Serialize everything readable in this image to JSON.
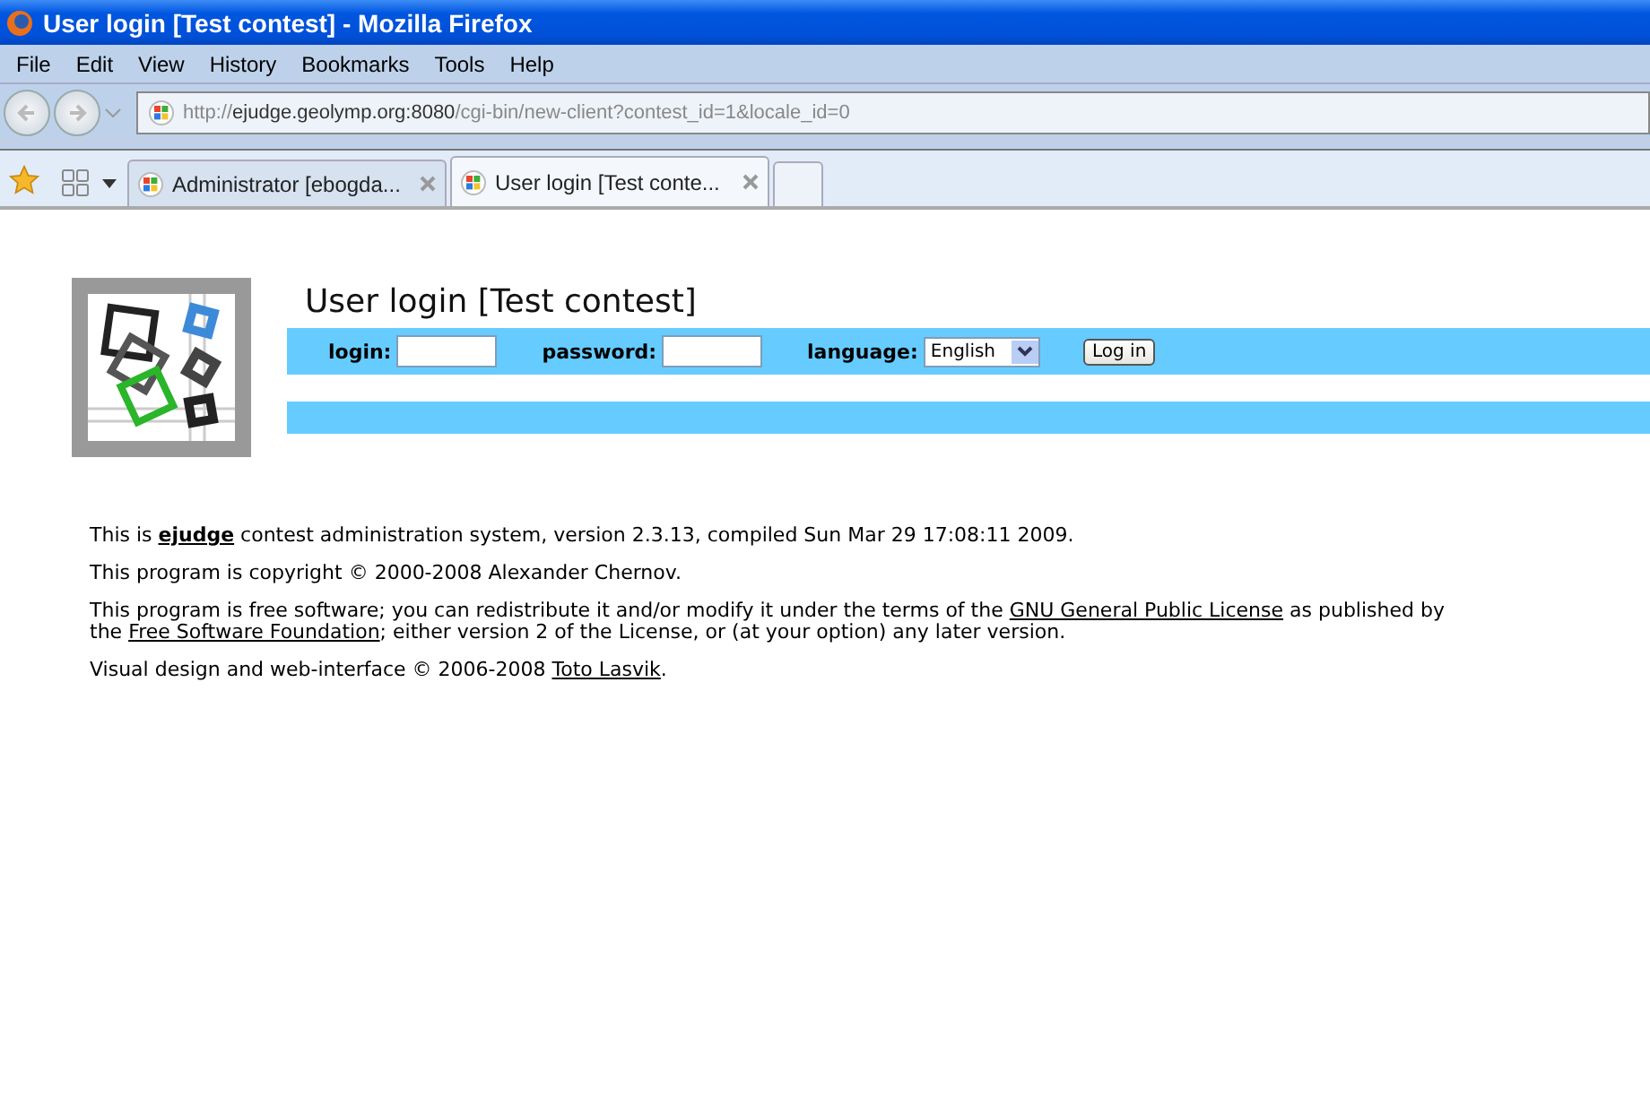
{
  "window": {
    "title": "User login [Test contest] - Mozilla Firefox"
  },
  "menu": [
    "File",
    "Edit",
    "View",
    "History",
    "Bookmarks",
    "Tools",
    "Help"
  ],
  "address": {
    "prefix": "http://",
    "host": "ejudge.geolymp.org:8080",
    "path": "/cgi-bin/new-client?contest_id=1&locale_id=0"
  },
  "tabs": [
    {
      "label": "Administrator [ebogda...",
      "selected": false
    },
    {
      "label": "User login [Test conte...",
      "selected": true
    }
  ],
  "page": {
    "heading": "User login [Test contest]",
    "form": {
      "login_label": "login:",
      "password_label": "password:",
      "language_label": "language:",
      "language": "English",
      "button": "Log in"
    },
    "footer": [
      [
        {
          "kind": "text",
          "text": "This is "
        },
        {
          "kind": "link",
          "text": "ejudge",
          "bold": true
        },
        {
          "kind": "text",
          "text": " contest administration system, version 2.3.13, compiled Sun Mar 29 17:08:11 2009."
        }
      ],
      [
        {
          "kind": "text",
          "text": "This program is copyright © 2000-2008 Alexander Chernov."
        }
      ],
      [
        {
          "kind": "text",
          "text": "This program is free software; you can redistribute it and/or modify it under the terms of the "
        },
        {
          "kind": "link",
          "text": "GNU General Public License",
          "bold": false
        },
        {
          "kind": "text",
          "text": " as published by the "
        },
        {
          "kind": "link",
          "text": "Free Software Foundation",
          "bold": false
        },
        {
          "kind": "text",
          "text": "; either version 2 of the License, or (at your option) any later version."
        }
      ],
      [
        {
          "kind": "text",
          "text": "Visual design and web-interface © 2006-2008 "
        },
        {
          "kind": "link",
          "text": "Toto Lasvik",
          "bold": false
        },
        {
          "kind": "text",
          "text": "."
        }
      ]
    ]
  }
}
